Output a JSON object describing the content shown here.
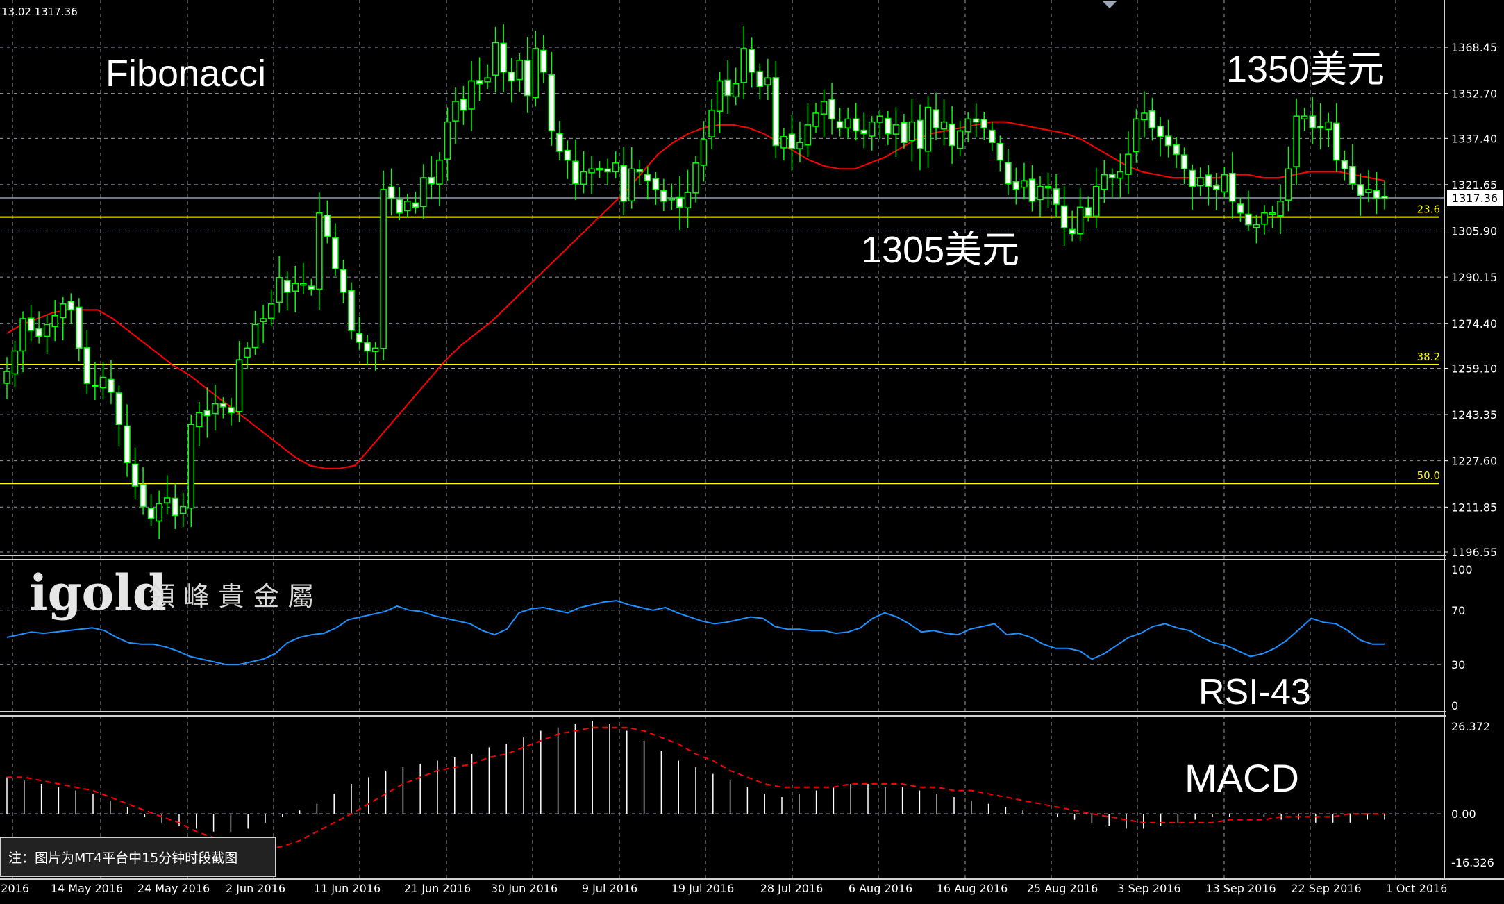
{
  "header": {
    "ohlc_text": "13.02 1317.36"
  },
  "annotations": {
    "fibonacci": "Fibonacci",
    "level_high": "1350美元",
    "level_low": "1305美元",
    "rsi_label": "RSI-43",
    "macd_label": "MACD",
    "brand_logo": "igold",
    "brand_name": "領 峰 貴 金 屬",
    "note": "注：图片为MT4平台中15分钟时段截图"
  },
  "colors": {
    "background": "#000000",
    "grid": "#8f9aa8",
    "bull_candle": "#00ff00",
    "bear_candle": "#ffffff",
    "moving_average": "#ff0000",
    "fib_lines": "#ffff00",
    "rsi_line": "#1e90ff",
    "macd_signal": "#ff0000",
    "macd_hist": "#ffffff",
    "price_line": "#8fa0b8"
  },
  "chart_data": [
    {
      "type": "candlestick",
      "title": "",
      "current_price": "1317.36",
      "y_ticks": [
        "1368.45",
        "1352.70",
        "1337.40",
        "1321.65",
        "1305.90",
        "1290.15",
        "1274.40",
        "1259.10",
        "1243.35",
        "1227.60",
        "1211.85",
        "1196.55"
      ],
      "ylim": [
        1196.55,
        1373.4
      ],
      "x_ticks": [
        "2016",
        "14 May 2016",
        "24 May 2016",
        "2 Jun 2016",
        "11 Jun 2016",
        "21 Jun 2016",
        "30 Jun 2016",
        "9 Jul 2016",
        "19 Jul 2016",
        "28 Jul 2016",
        "6 Aug 2016",
        "16 Aug 2016",
        "25 Aug 2016",
        "3 Sep 2016",
        "13 Sep 2016",
        "22 Sep 2016",
        "1 Oct 2016"
      ],
      "fibonacci_levels": [
        {
          "label": "23.6",
          "value": 1310.6
        },
        {
          "label": "38.2",
          "value": 1260.4
        },
        {
          "label": "50.0",
          "value": 1219.9
        }
      ],
      "close_series": [
        1258,
        1265,
        1276,
        1272,
        1270,
        1274,
        1277,
        1281,
        1279,
        1266,
        1254,
        1253,
        1256,
        1251,
        1240,
        1227,
        1219,
        1212,
        1208,
        1213,
        1215,
        1209,
        1212,
        1240,
        1244,
        1243,
        1247,
        1246,
        1244,
        1262,
        1266,
        1274,
        1276,
        1281,
        1290,
        1285,
        1288,
        1288,
        1286,
        1312,
        1304,
        1293,
        1285,
        1272,
        1268,
        1265,
        1266,
        1320,
        1317,
        1312,
        1316,
        1314,
        1324,
        1322,
        1330,
        1343,
        1350,
        1347,
        1357,
        1356,
        1358,
        1370,
        1360,
        1357,
        1364,
        1352,
        1368,
        1360,
        1340,
        1333,
        1330,
        1322,
        1326,
        1327,
        1327,
        1326,
        1329,
        1316,
        1327,
        1326,
        1323,
        1320,
        1316,
        1317,
        1314,
        1319,
        1329,
        1337,
        1347,
        1357,
        1352,
        1356,
        1368,
        1360,
        1355,
        1358,
        1335,
        1338,
        1334,
        1336,
        1342,
        1346,
        1350,
        1344,
        1341,
        1344,
        1340,
        1339,
        1343,
        1345,
        1339,
        1342,
        1336,
        1343,
        1334,
        1348,
        1341,
        1343,
        1335,
        1340,
        1344,
        1343,
        1341,
        1336,
        1330,
        1322,
        1320,
        1323,
        1316,
        1321,
        1321,
        1315,
        1307,
        1305,
        1314,
        1311,
        1321,
        1325,
        1324,
        1326,
        1332,
        1344,
        1346,
        1341,
        1338,
        1335,
        1332,
        1327,
        1321,
        1324,
        1321,
        1320,
        1325,
        1316,
        1312,
        1308,
        1308,
        1312,
        1312,
        1316,
        1327,
        1345,
        1345,
        1341,
        1341,
        1343,
        1330,
        1327,
        1322,
        1318,
        1320,
        1317,
        1317
      ],
      "ma_series": [
        1271,
        1274,
        1276,
        1278,
        1279,
        1279,
        1279,
        1276,
        1272,
        1268,
        1264,
        1260,
        1257,
        1253,
        1249,
        1245,
        1241,
        1237,
        1233,
        1229,
        1226,
        1225,
        1225,
        1226,
        1232,
        1238,
        1244,
        1250,
        1256,
        1262,
        1267,
        1271,
        1275,
        1280,
        1285,
        1290,
        1295,
        1300,
        1305,
        1310,
        1315,
        1320,
        1326,
        1332,
        1336,
        1339,
        1341,
        1342,
        1342,
        1341,
        1339,
        1336,
        1333,
        1330,
        1328,
        1327,
        1327,
        1329,
        1331,
        1334,
        1337,
        1339,
        1340,
        1341,
        1342,
        1343,
        1343,
        1342,
        1341,
        1340,
        1339,
        1337,
        1334,
        1331,
        1328,
        1326,
        1325,
        1324,
        1324,
        1324,
        1324,
        1325,
        1325,
        1324,
        1324,
        1325,
        1326,
        1326,
        1326,
        1325,
        1324,
        1323
      ],
      "series": [
        {
          "name": "",
          "values": []
        }
      ]
    },
    {
      "type": "line",
      "title": "",
      "indicator": "RSI",
      "y_ticks": [
        "100",
        "70",
        "30",
        "0"
      ],
      "ylim": [
        0,
        100
      ],
      "values": [
        50,
        52,
        54,
        53,
        54,
        55,
        56,
        57,
        55,
        50,
        46,
        45,
        45,
        43,
        40,
        36,
        34,
        32,
        30,
        30,
        32,
        34,
        38,
        46,
        50,
        52,
        53,
        57,
        63,
        65,
        67,
        69,
        73,
        70,
        69,
        66,
        64,
        62,
        60,
        55,
        52,
        56,
        68,
        71,
        72,
        70,
        68,
        72,
        74,
        76,
        77,
        74,
        72,
        70,
        72,
        68,
        65,
        62,
        60,
        61,
        63,
        65,
        64,
        58,
        56,
        56,
        55,
        55,
        53,
        54,
        57,
        64,
        68,
        65,
        60,
        54,
        55,
        53,
        52,
        56,
        58,
        60,
        52,
        53,
        50,
        45,
        42,
        42,
        40,
        34,
        38,
        44,
        50,
        53,
        58,
        60,
        57,
        55,
        50,
        46,
        44,
        40,
        36,
        38,
        42,
        48,
        56,
        64,
        61,
        60,
        55,
        48,
        45,
        45
      ]
    },
    {
      "type": "bar",
      "title": "",
      "indicator": "MACD",
      "y_ticks": [
        "26.372",
        "0.00",
        "-16.326"
      ],
      "ylim": [
        -16.326,
        26.372
      ],
      "histogram": [
        11,
        10,
        9,
        8,
        7,
        6,
        4,
        2,
        -1,
        -3,
        -4,
        -5,
        -6,
        -6,
        -5,
        -3,
        -1,
        1,
        3,
        6,
        9,
        11,
        13,
        14,
        15,
        16,
        17,
        18,
        20,
        21,
        23,
        25,
        26,
        27,
        28,
        27,
        25,
        22,
        19,
        16,
        14,
        12,
        10,
        8,
        6,
        5,
        6,
        7,
        8,
        9,
        9,
        8,
        8,
        7,
        6,
        5,
        4,
        3,
        2,
        1,
        0,
        -1,
        -2,
        -3,
        -4,
        -5,
        -5,
        -4,
        -3,
        -2,
        -1,
        -1,
        0,
        -1,
        -2,
        -2,
        -3,
        -3,
        -3,
        -2,
        -2
      ],
      "signal": [
        11,
        11,
        10,
        9,
        8,
        7,
        5,
        3,
        1,
        -1,
        -3,
        -6,
        -8,
        -10,
        -11,
        -12,
        -11,
        -9,
        -6,
        -3,
        0,
        3,
        6,
        9,
        11,
        13,
        14,
        15,
        17,
        18,
        20,
        22,
        24,
        25,
        26,
        26,
        26,
        25,
        23,
        21,
        18,
        16,
        13,
        11,
        9,
        8,
        8,
        8,
        8,
        9,
        9,
        9,
        9,
        8,
        8,
        7,
        7,
        6,
        5,
        4,
        3,
        2,
        1,
        0,
        -1,
        -2,
        -3,
        -3,
        -3,
        -3,
        -3,
        -2,
        -2,
        -2,
        -1,
        -1,
        -1,
        -1,
        0,
        0,
        0
      ]
    }
  ]
}
